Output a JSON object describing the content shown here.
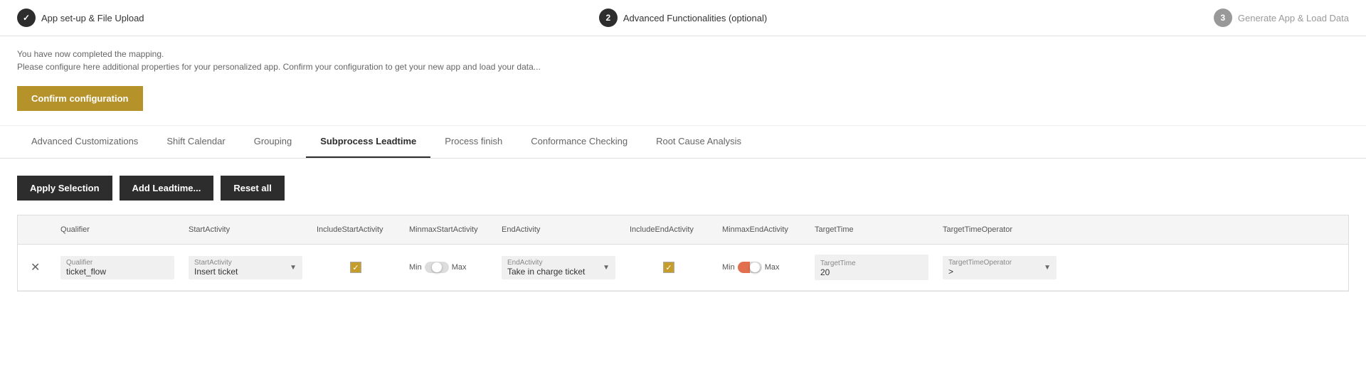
{
  "nav": {
    "step1": {
      "number": "✓",
      "label": "App set-up & File Upload",
      "state": "active"
    },
    "step2": {
      "number": "2",
      "label": "Advanced Functionalities (optional)",
      "state": "active"
    },
    "step3": {
      "number": "3",
      "label": "Generate App & Load Data",
      "state": "inactive"
    }
  },
  "message": {
    "line1": "You have now completed the mapping.",
    "line2": "Please configure here additional properties for your personalized app. Confirm your configuration to get your new app and load your data..."
  },
  "confirmButton": "Confirm configuration",
  "tabs": [
    {
      "id": "advanced",
      "label": "Advanced Customizations",
      "active": false
    },
    {
      "id": "shift",
      "label": "Shift Calendar",
      "active": false
    },
    {
      "id": "grouping",
      "label": "Grouping",
      "active": false
    },
    {
      "id": "subprocess",
      "label": "Subprocess Leadtime",
      "active": true
    },
    {
      "id": "process",
      "label": "Process finish",
      "active": false
    },
    {
      "id": "conformance",
      "label": "Conformance Checking",
      "active": false
    },
    {
      "id": "rootcause",
      "label": "Root Cause Analysis",
      "active": false
    }
  ],
  "buttons": {
    "applySelection": "Apply Selection",
    "addLeadtime": "Add Leadtime...",
    "resetAll": "Reset all"
  },
  "table": {
    "headers": [
      "",
      "Qualifier",
      "StartActivity",
      "IncludeStartActivity",
      "MinmaxStartActivity",
      "EndActivity",
      "IncludeEndActivity",
      "MinmaxEndActivity",
      "TargetTime",
      "TargetTimeOperator"
    ],
    "rows": [
      {
        "qualifier": {
          "label": "Qualifier",
          "value": "ticket_flow"
        },
        "startActivity": {
          "label": "StartActivity",
          "value": "Insert ticket"
        },
        "includeStart": true,
        "minStart": {
          "min": "Min",
          "max": "Max",
          "state": "right"
        },
        "endActivity": {
          "label": "EndActivity",
          "value": "Take in charge ticket"
        },
        "includeEnd": true,
        "minEnd": {
          "min": "Min",
          "max": "Max",
          "state": "middle"
        },
        "targetTime": {
          "label": "TargetTime",
          "value": "20"
        },
        "targetTimeOp": {
          "label": "TargetTimeOperator",
          "value": ">"
        }
      }
    ]
  }
}
